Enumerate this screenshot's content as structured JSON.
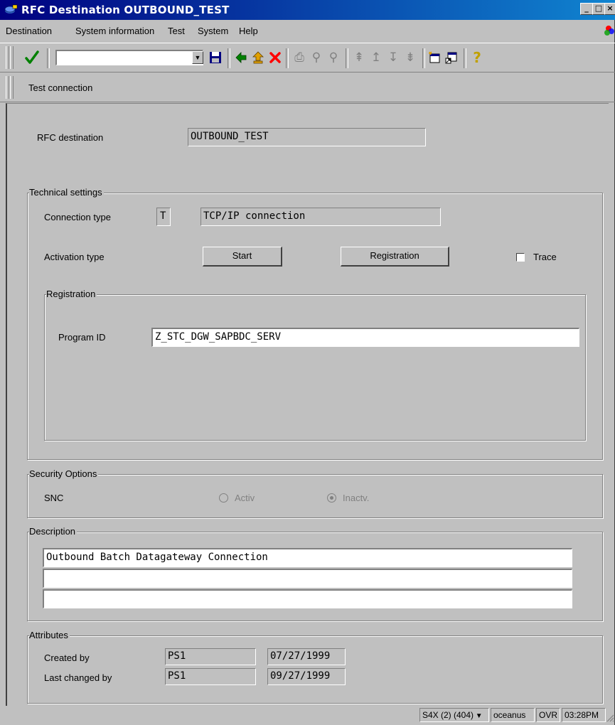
{
  "window": {
    "title": "RFC Destination OUTBOUND_TEST",
    "controls": {
      "minimize": "_",
      "maximize": "□",
      "close": "×"
    }
  },
  "menu": [
    {
      "label": "Destination"
    },
    {
      "label": "System information"
    },
    {
      "label": "Test"
    },
    {
      "label": "System"
    },
    {
      "label": "Help"
    }
  ],
  "toolbar": {
    "command_field_value": "",
    "icons": [
      "check-icon",
      "save-icon",
      "back-icon",
      "exit-icon",
      "cancel-icon",
      "print-icon",
      "find-icon",
      "find-next-icon",
      "first-page-icon",
      "previous-page-icon",
      "next-page-icon",
      "last-page-icon",
      "create-session-icon",
      "generate-shortcut-icon",
      "help-icon"
    ],
    "colors": {
      "check": "#008000",
      "back": "#008000",
      "exit": "#c08000",
      "cancel": "#ff0000",
      "save": "#000080",
      "help": "#c0c000"
    }
  },
  "application_toolbar": {
    "test_connection": "Test connection"
  },
  "rfc_destination": {
    "label": "RFC destination",
    "value": "OUTBOUND_TEST"
  },
  "technical_settings": {
    "title": "Technical settings",
    "connection_type_label": "Connection type",
    "connection_type_code": "T",
    "connection_type_desc": "TCP/IP connection",
    "activation_type_label": "Activation type",
    "start_button": "Start",
    "registration_button": "Registration",
    "trace_label": "Trace",
    "registration": {
      "title": "Registration",
      "program_id_label": "Program ID",
      "program_id_value": "Z_STC_DGW_SAPBDC_SERV"
    }
  },
  "security": {
    "title": "Security Options",
    "snc_label": "SNC",
    "activ_label": "Activ",
    "inactv_label": "Inactv."
  },
  "description": {
    "title": "Description",
    "line1": "Outbound Batch Datagateway Connection",
    "line2": "",
    "line3": ""
  },
  "attributes": {
    "title": "Attributes",
    "created_by_label": "Created by",
    "created_by_user": "PS1",
    "created_by_date": "07/27/1999",
    "changed_by_label": "Last changed by",
    "changed_by_user": "PS1",
    "changed_by_date": "09/27/1999"
  },
  "status_bar": {
    "system": "S4X (2) (404)",
    "host": "oceanus",
    "mode": "OVR",
    "time": "03:28PM"
  }
}
